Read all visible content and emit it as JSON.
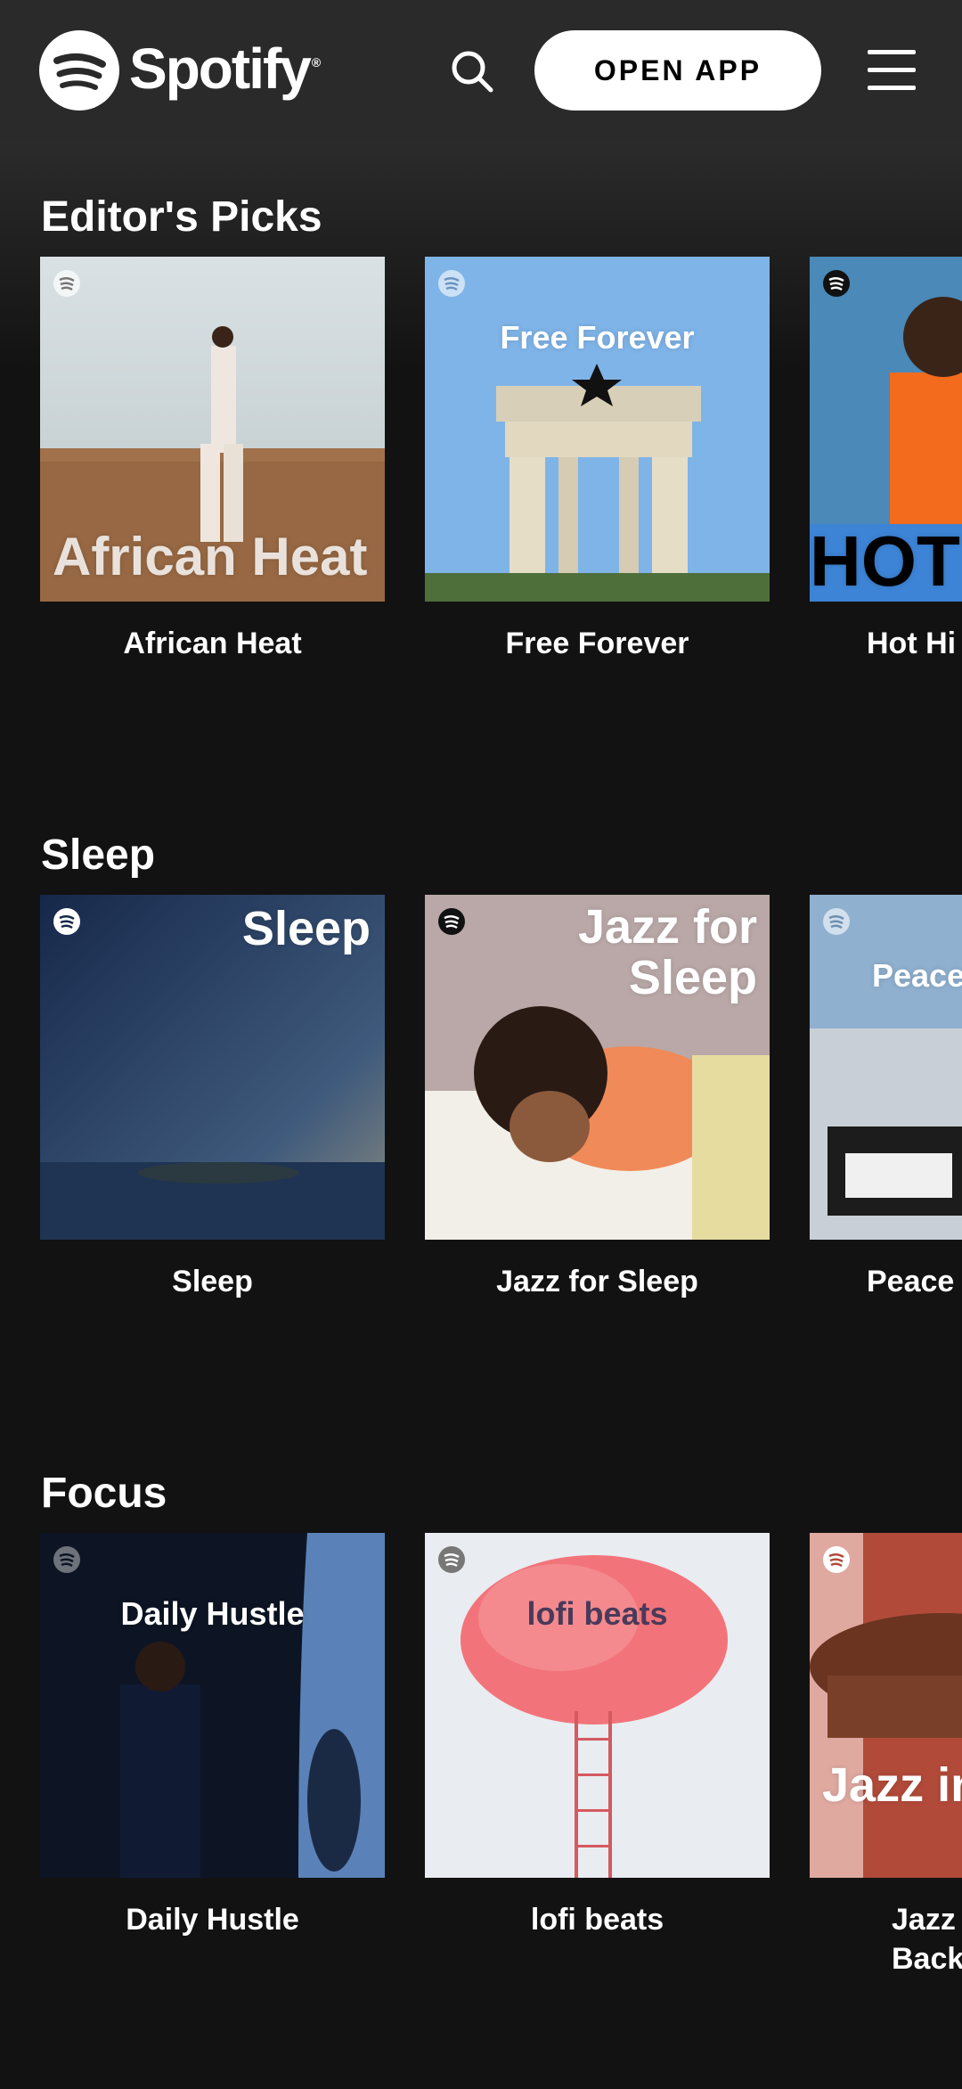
{
  "header": {
    "brand": "Spotify",
    "open_app_label": "OPEN APP",
    "icons": {
      "logo": "spotify-logo",
      "search": "search-icon",
      "menu": "hamburger-menu-icon"
    }
  },
  "sections": [
    {
      "title": "Editor's Picks",
      "cards": [
        {
          "label": "African Heat",
          "cover_text": "African Heat"
        },
        {
          "label": "Free Forever",
          "cover_text": "Free Forever"
        },
        {
          "label": "Hot Hi",
          "cover_text": "HOT"
        }
      ]
    },
    {
      "title": "Sleep",
      "cards": [
        {
          "label": "Sleep",
          "cover_text": "Sleep"
        },
        {
          "label": "Jazz for Sleep",
          "cover_text": "Jazz for Sleep"
        },
        {
          "label": "Peace",
          "cover_text": "Peace"
        }
      ]
    },
    {
      "title": "Focus",
      "cards": [
        {
          "label": "Daily Hustle",
          "cover_text": "Daily Hustle"
        },
        {
          "label": "lofi beats",
          "cover_text": "lofi beats"
        },
        {
          "label": "Jazz Back",
          "cover_text": "Jazz in Backg"
        }
      ]
    }
  ],
  "colors": {
    "background": "#121212",
    "header": "#2a2a2a",
    "button": "#ffffff"
  }
}
